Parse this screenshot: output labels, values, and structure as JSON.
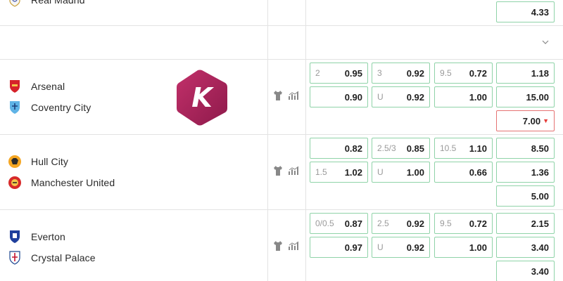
{
  "top_match": {
    "team": "Real Madrid",
    "odd": "4.33"
  },
  "matches": [
    {
      "home": "Arsenal",
      "away": "Coventry City",
      "hdp": [
        {
          "line": "2",
          "price": "0.95"
        },
        {
          "line": "",
          "price": "0.90"
        }
      ],
      "ou": [
        {
          "line": "3",
          "price": "0.92"
        },
        {
          "line": "U",
          "price": "0.92"
        }
      ],
      "half": [
        {
          "line": "9.5",
          "price": "0.72"
        },
        {
          "line": "",
          "price": "1.00"
        }
      ],
      "x12": [
        "1.18",
        "15.00",
        "7.00"
      ]
    },
    {
      "home": "Hull City",
      "away": "Manchester United",
      "hdp": [
        {
          "line": "",
          "price": "0.82"
        },
        {
          "line": "1.5",
          "price": "1.02"
        }
      ],
      "ou": [
        {
          "line": "2.5/3",
          "price": "0.85"
        },
        {
          "line": "U",
          "price": "1.00"
        }
      ],
      "half": [
        {
          "line": "10.5",
          "price": "1.10"
        },
        {
          "line": "",
          "price": "0.66"
        }
      ],
      "x12": [
        "8.50",
        "1.36",
        "5.00"
      ]
    },
    {
      "home": "Everton",
      "away": "Crystal Palace",
      "hdp": [
        {
          "line": "0/0.5",
          "price": "0.87"
        },
        {
          "line": "",
          "price": "0.97"
        }
      ],
      "ou": [
        {
          "line": "2.5",
          "price": "0.92"
        },
        {
          "line": "U",
          "price": "0.92"
        }
      ],
      "half": [
        {
          "line": "9.5",
          "price": "0.72"
        },
        {
          "line": "",
          "price": "1.00"
        }
      ],
      "x12": [
        "2.15",
        "3.40",
        "3.40"
      ]
    }
  ],
  "logo": {
    "letter": "K",
    "color": "#b0245f"
  },
  "colors": {
    "odd_border": "#8fd3a8",
    "drop_border": "#e57373",
    "drop_arrow": "#e53935"
  },
  "icons": [
    "jersey-icon",
    "stats-icon",
    "chevron-down-icon",
    "real-madrid-crest-icon",
    "arsenal-crest-icon",
    "coventry-crest-icon",
    "hull-crest-icon",
    "man-utd-crest-icon",
    "everton-crest-icon",
    "crystal-palace-crest-icon"
  ]
}
